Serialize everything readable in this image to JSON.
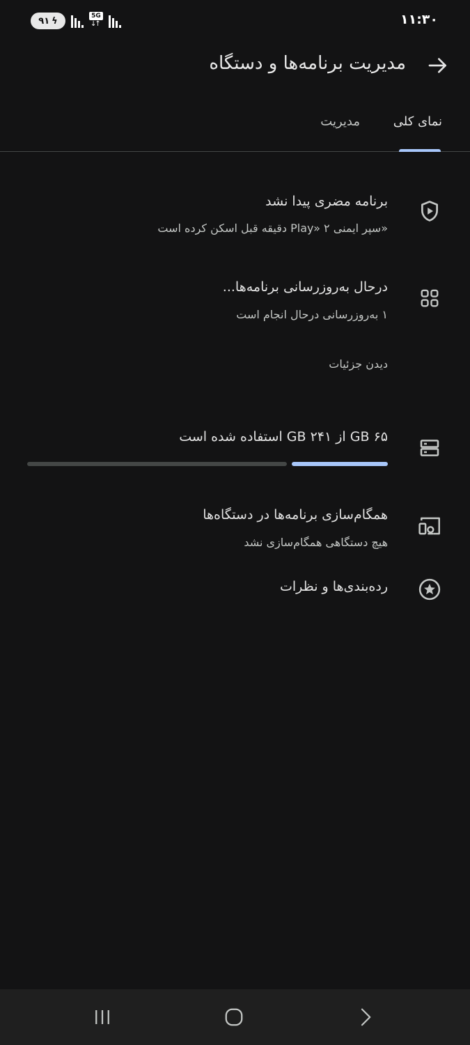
{
  "status_bar": {
    "time": "۱۱:۳۰",
    "battery": "۹۱",
    "network": "5G"
  },
  "header": {
    "title": "مدیریت برنامه‌ها و دستگاه",
    "back_icon": "arrow-forward-icon"
  },
  "tabs": [
    {
      "label": "نمای کلی",
      "active": true
    },
    {
      "label": "مدیریت",
      "active": false
    }
  ],
  "protect": {
    "title": "برنامه مضری پیدا نشد",
    "subtitle": "«سپر ایمنی Play» ۲ دقیقه قبل اسکن کرده است",
    "icon": "shield-play-icon"
  },
  "updates": {
    "title": "درحال به‌روزرسانی برنامه‌ها...",
    "subtitle": "۱ به‌روزرسانی درحال انجام است",
    "link": "دیدن جزئیات",
    "icon": "apps-grid-icon"
  },
  "storage": {
    "title": "۶۵ GB از ۲۴۱ GB استفاده شده است",
    "used_gb": 65,
    "total_gb": 241,
    "icon": "storage-icon"
  },
  "sync": {
    "title": "همگام‌سازی برنامه‌ها در دستگاه‌ها",
    "subtitle": "هیچ دستگاهی همگام‌سازی نشد",
    "icon": "devices-icon"
  },
  "ratings": {
    "title": "رده‌بندی‌ها و نظرات",
    "icon": "star-circle-icon"
  },
  "colors": {
    "background": "#131314",
    "accent": "#a8c7fa",
    "nav_bar": "#1f1f1f"
  }
}
